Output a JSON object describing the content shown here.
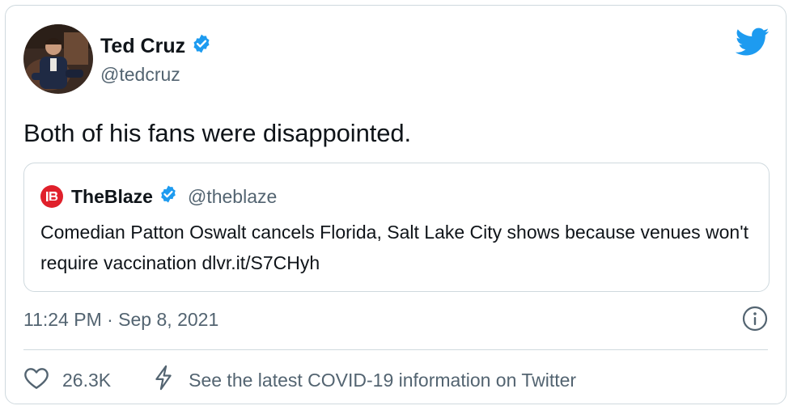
{
  "tweet": {
    "author_name": "Ted Cruz",
    "author_handle": "@tedcruz",
    "text": "Both of his fans were disappointed.",
    "timestamp": "11:24 PM · Sep 8, 2021",
    "likes": "26.3K",
    "covid_link": "See the latest COVID-19 information on Twitter"
  },
  "quote": {
    "name": "TheBlaze",
    "handle": "@theblaze",
    "text": "Comedian Patton Oswalt cancels Florida, Salt Lake City shows because venues won't require vaccination dlvr.it/S7CHyh"
  },
  "colors": {
    "twitter_blue": "#1d9bf0",
    "blaze_red": "#e0202b",
    "secondary_text": "#536471",
    "border": "#cfd9de"
  },
  "icons": [
    "avatar",
    "verified-badge-icon",
    "twitter-bird-icon",
    "theblaze-logo-icon",
    "info-icon",
    "heart-icon",
    "lightning-icon"
  ]
}
